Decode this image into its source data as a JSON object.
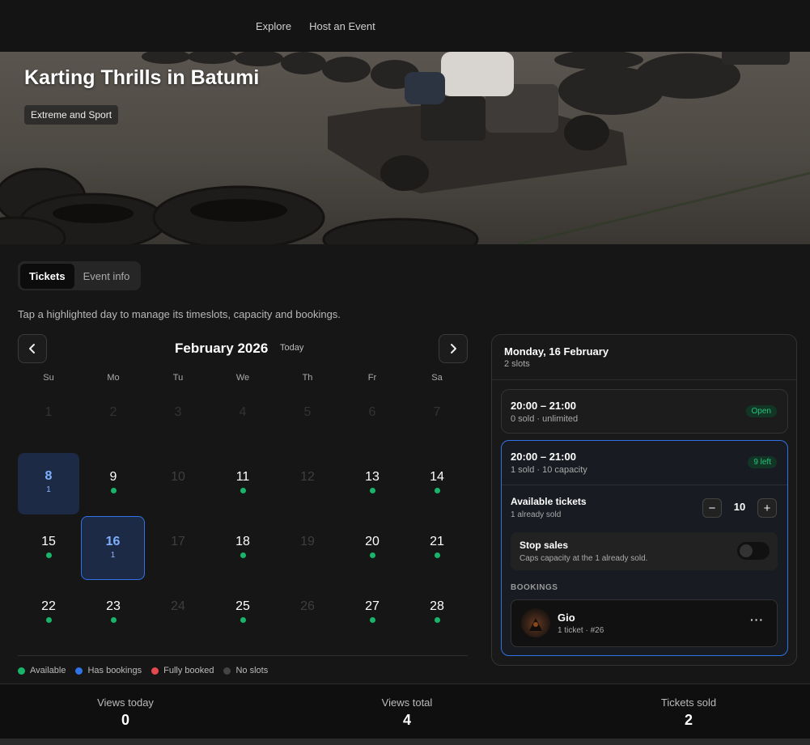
{
  "nav": {
    "explore": "Explore",
    "host": "Host an Event"
  },
  "hero": {
    "title": "Karting Thrills in Batumi",
    "tag": "Extreme and Sport"
  },
  "tabs": {
    "tickets": "Tickets",
    "event_info": "Event info"
  },
  "hint": "Tap a highlighted day to manage its timeslots, capacity and bookings.",
  "calendar": {
    "month": "February 2026",
    "today": "Today",
    "prev_icon": "chevron-left-icon",
    "next_icon": "chevron-right-icon",
    "weekdays": [
      "Su",
      "Mo",
      "Tu",
      "We",
      "Th",
      "Fr",
      "Sa"
    ],
    "week1": [
      "1",
      "2",
      "3",
      "4",
      "5",
      "6",
      "7"
    ],
    "day8": {
      "num": "8",
      "sub": "1"
    },
    "day9": "9",
    "day10": "10",
    "day11": "11",
    "day12": "12",
    "day13": "13",
    "day14": "14",
    "day15": "15",
    "day16": {
      "num": "16",
      "sub": "1"
    },
    "day17": "17",
    "day18": "18",
    "day19": "19",
    "day20": "20",
    "day21": "21",
    "day22": "22",
    "day23": "23",
    "day24": "24",
    "day25": "25",
    "day26": "26",
    "day27": "27",
    "day28": "28"
  },
  "legend": {
    "available": "Available",
    "has_bookings": "Has bookings",
    "fully_booked": "Fully booked",
    "no_slots": "No slots"
  },
  "colors": {
    "available": "#19b46b",
    "has_bookings": "#2f73e6",
    "fully_booked": "#e5484d",
    "no_slots": "#444444"
  },
  "panel": {
    "date": "Monday, 16 February",
    "slots": "2 slots",
    "slot1": {
      "time": "20:00 – 21:00",
      "sub": "0 sold · unlimited",
      "badge": "Open"
    },
    "slot2": {
      "time": "20:00 – 21:00",
      "sub": "1 sold · 10 capacity",
      "badge": "9 left"
    },
    "available_tickets": {
      "label": "Available tickets",
      "sub": "1 already sold",
      "value": "10",
      "minus": "−",
      "plus": "+"
    },
    "stop_sales": {
      "label": "Stop sales",
      "sub": "Caps capacity at the 1 already sold."
    },
    "bookings_label": "BOOKINGS",
    "booking": {
      "name": "Gio",
      "sub": "1 ticket · #26",
      "more": "···"
    }
  },
  "stats": {
    "views_today": {
      "label": "Views today",
      "value": "0"
    },
    "views_total": {
      "label": "Views total",
      "value": "4"
    },
    "tickets_sold": {
      "label": "Tickets sold",
      "value": "2"
    }
  }
}
